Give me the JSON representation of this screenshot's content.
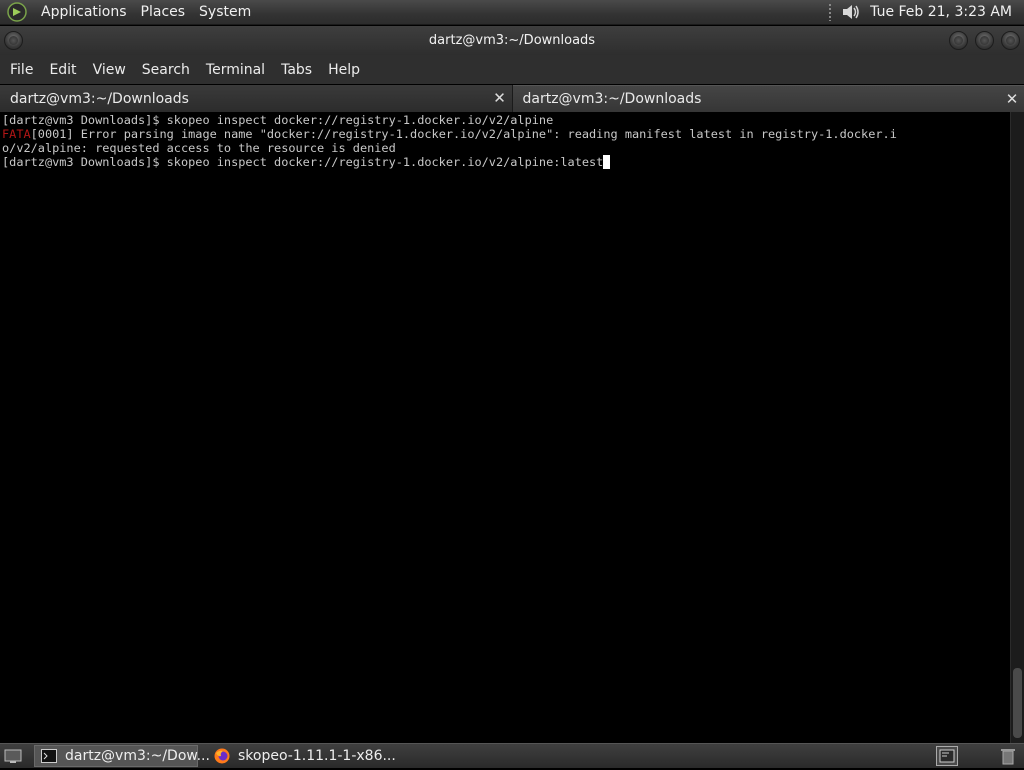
{
  "top_panel": {
    "menus": [
      "Applications",
      "Places",
      "System"
    ],
    "clock": "Tue Feb 21,  3:23 AM",
    "icons": {
      "logo": "mate-logo-icon",
      "volume": "volume-icon"
    }
  },
  "window": {
    "title": "dartz@vm3:~/Downloads"
  },
  "menubar": {
    "items": [
      "File",
      "Edit",
      "View",
      "Search",
      "Terminal",
      "Tabs",
      "Help"
    ]
  },
  "tabs": [
    {
      "label": "dartz@vm3:~/Downloads",
      "close": "✕",
      "active": false
    },
    {
      "label": "dartz@vm3:~/Downloads",
      "close": "✕",
      "active": true
    }
  ],
  "terminal": {
    "line1": "[dartz@vm3 Downloads]$ skopeo inspect docker://registry-1.docker.io/v2/alpine",
    "line2_level": "FATA",
    "line2_rest": "[0001] Error parsing image name \"docker://registry-1.docker.io/v2/alpine\": reading manifest latest in registry-1.docker.i",
    "line3": "o/v2/alpine: requested access to the resource is denied",
    "line4": "[dartz@vm3 Downloads]$ skopeo inspect docker://registry-1.docker.io/v2/alpine:latest"
  },
  "taskbar": {
    "tasks": [
      {
        "label": "dartz@vm3:~/Dow...",
        "icon": "terminal-icon",
        "active": true
      },
      {
        "label": "skopeo-1.11.1-1-x86...",
        "icon": "firefox-icon",
        "active": false
      }
    ]
  },
  "colors": {
    "fatal": "#b01616",
    "terminal_fg": "#c8c8c8",
    "terminal_bg": "#000000"
  }
}
